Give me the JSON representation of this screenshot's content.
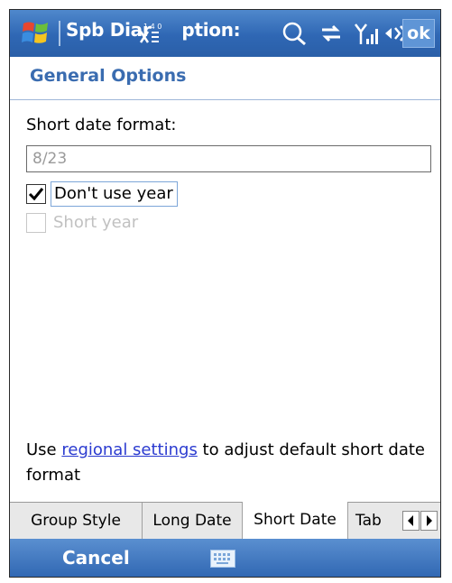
{
  "titlebar": {
    "title": "Spb Diar",
    "title_suffix": "ption:",
    "ok_label": "ok",
    "icons": [
      "windows-logo-icon",
      "input-method-icon",
      "search-icon",
      "sync-icon",
      "signal-icon",
      "volume-icon"
    ]
  },
  "page": {
    "title": "General Options",
    "short_date_label": "Short date format:",
    "short_date_value": "8/23",
    "checkboxes": [
      {
        "label": "Don't use year",
        "checked": true,
        "enabled": true
      },
      {
        "label": "Short year",
        "checked": false,
        "enabled": false
      }
    ],
    "info_prefix": "Use ",
    "info_link": "regional settings",
    "info_suffix": " to adjust default short date format"
  },
  "tabs": [
    {
      "label": "Group Style",
      "active": false
    },
    {
      "label": "Long Date",
      "active": false
    },
    {
      "label": "Short Date",
      "active": true
    },
    {
      "label": "Tab",
      "active": false
    }
  ],
  "bottombar": {
    "cancel_label": "Cancel"
  },
  "colors": {
    "titlebar": "#2f67b4",
    "accent_text": "#3a6cb0",
    "link": "#2b3bd0"
  }
}
